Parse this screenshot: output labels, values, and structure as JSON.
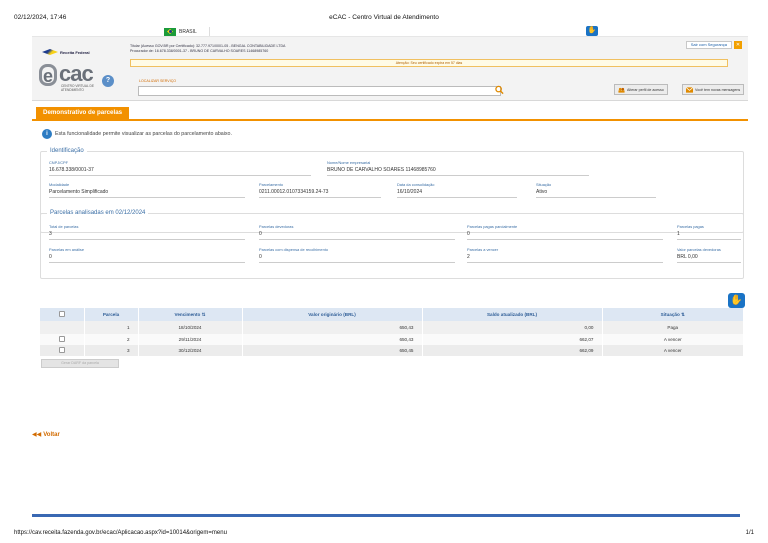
{
  "print": {
    "date": "02/12/2024, 17:46",
    "title": "eCAC - Centro Virtual de Atendimento",
    "url": "https://cav.receita.fazenda.gov.br/ecac/Aplicacao.aspx?id=10014&origem=menu",
    "page": "1/1"
  },
  "govbar": {
    "country": "BRASIL"
  },
  "header": {
    "rf_logo": "Receita Federal",
    "titular_line1": "Titular (Acesso GOV.BR por Certificado): 32.777.971/0001-05 - BENGAL CONTABILIDADE LTDA",
    "titular_line2": "Procurador de: 16.678.338/0001-37 - BRUNO DE CARVALHO SOARES 11468985760",
    "alert": "Atenção: Seu certificado expira em 57 dias",
    "sair": "Sair com Segurança",
    "ecac_e": "e",
    "ecac_cac": "cac",
    "ecac_sub": "CENTRO VIRTUAL DE ATENDIMENTO",
    "help": "?",
    "search_label": "LOCALIZAR SERVIÇO",
    "btn_perfil": "Alterar perfil de acesso",
    "btn_msg": "Você tem novas mensagens"
  },
  "tab": "Demonstrativo de parcelas",
  "info_text": "Esta funcionalidade permite visualizar as parcelas do parcelamento abaixo.",
  "identificacao": {
    "legend": "Identificação",
    "cnpj_label": "CNPJ/CPF",
    "cnpj": "16.678.338/0001-37",
    "nome_label": "Nome/Nome empresarial",
    "nome": "BRUNO DE CARVALHO SOARES 11468985760",
    "modalidade_label": "Modalidade",
    "modalidade": "Parcelamento Simplificado",
    "parcelamento_label": "Parcelamento",
    "parcelamento": "0211.00012.0107334159.24-73",
    "data_label": "Data da consolidação",
    "data": "16/10/2024",
    "situacao_label": "Situação",
    "situacao": "Ativo"
  },
  "analisadas": {
    "legend": "Parcelas analisadas em 02/12/2024",
    "total_label": "Total de parcelas",
    "total": "3",
    "devedoras_label": "Parcelas devedoras",
    "devedoras": "0",
    "parcial_label": "Parcelas pagas parcialmente",
    "parcial": "0",
    "pagas_label": "Parcelas pagas",
    "pagas": "1",
    "analise_label": "Parcelas em análise",
    "analise": "0",
    "dispensa_label": "Parcelas com dispensa de recolhimento",
    "dispensa": "0",
    "vencer_label": "Parcelas a vencer",
    "vencer": "2",
    "valor_dev_label": "Valor parcelas devedoras",
    "valor_dev": "BRL 0,00"
  },
  "table": {
    "headers": [
      "",
      "Parcela",
      "Vencimento ⇅",
      "Valor originário (BRL)",
      "Saldo atualizado (BRL)",
      "Situação ⇅"
    ],
    "rows": [
      {
        "parcela": "1",
        "venc": "18/10/2024",
        "valor": "650,43",
        "saldo": "0,00",
        "sit": "Paga"
      },
      {
        "parcela": "2",
        "venc": "29/11/2024",
        "valor": "650,43",
        "saldo": "662,07",
        "sit": "A vencer"
      },
      {
        "parcela": "3",
        "venc": "30/12/2024",
        "valor": "650,45",
        "saldo": "662,09",
        "sit": "A vencer"
      }
    ]
  },
  "gerar_btn": "Gerar DARF da parcela",
  "voltar": "Voltar",
  "colors": {
    "accent": "#f29100",
    "blue": "#2f5e97",
    "bar": "#3968b3"
  }
}
